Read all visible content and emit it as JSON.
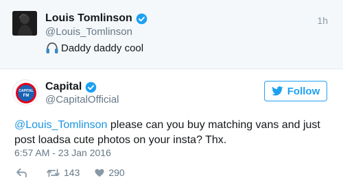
{
  "quoted_tweet": {
    "name": "Louis Tomlinson",
    "handle": "@Louis_Tomlinson",
    "time": "1h",
    "text": "Daddy daddy cool",
    "emoji_icon": "headphones-icon"
  },
  "tweet": {
    "name": "Capital",
    "handle": "@CapitalOfficial",
    "avatar_text": "95-106 CAPITAL FM",
    "follow_label": "Follow",
    "mention": "@Louis_Tomlinson",
    "body": " please can you buy matching vans and just post loadsa cute photos on your insta? Thx.",
    "date": "6:57 AM - 23 Jan 2016",
    "retweets": "143",
    "likes": "290"
  },
  "colors": {
    "accent": "#1da1f2",
    "link": "#1b95e0",
    "muted": "#657786",
    "quoted_bg": "#f5f8fa"
  }
}
